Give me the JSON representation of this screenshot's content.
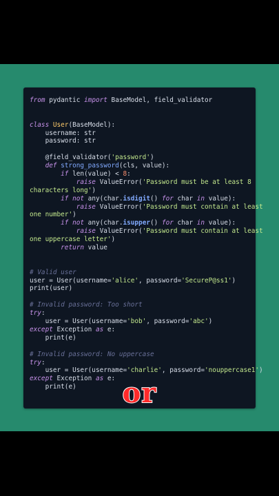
{
  "code_lines": [
    [
      {
        "t": "from",
        "c": "kw-it"
      },
      {
        "t": " pydantic ",
        "c": "plain"
      },
      {
        "t": "import",
        "c": "kw-it"
      },
      {
        "t": " BaseModel, field_validator",
        "c": "plain"
      }
    ],
    [],
    [],
    [
      {
        "t": "class",
        "c": "kw-it"
      },
      {
        "t": " User",
        "c": "cls"
      },
      {
        "t": "(BaseModel):",
        "c": "plain"
      }
    ],
    [
      {
        "t": "    username: str",
        "c": "plain"
      }
    ],
    [
      {
        "t": "    password: str",
        "c": "plain"
      }
    ],
    [],
    [
      {
        "t": "    @field_validator(",
        "c": "plain"
      },
      {
        "t": "'password'",
        "c": "str"
      },
      {
        "t": ")",
        "c": "plain"
      }
    ],
    [
      {
        "t": "    def",
        "c": "kw-it"
      },
      {
        "t": " strong_password",
        "c": "fn"
      },
      {
        "t": "(cls, value):",
        "c": "plain"
      }
    ],
    [
      {
        "t": "        if",
        "c": "kw-it"
      },
      {
        "t": " len(value) < ",
        "c": "plain"
      },
      {
        "t": "8",
        "c": "num"
      },
      {
        "t": ":",
        "c": "plain"
      }
    ],
    [
      {
        "t": "            raise",
        "c": "kw-it"
      },
      {
        "t": " ValueError(",
        "c": "plain"
      },
      {
        "t": "'Password must be at least 8",
        "c": "str"
      }
    ],
    [
      {
        "t": "characters long'",
        "c": "str"
      },
      {
        "t": ")",
        "c": "plain"
      }
    ],
    [
      {
        "t": "        if",
        "c": "kw-it"
      },
      {
        "t": " not",
        "c": "kw-it"
      },
      {
        "t": " any(char.",
        "c": "plain"
      },
      {
        "t": "isdigit",
        "c": "fn bold"
      },
      {
        "t": "() ",
        "c": "plain"
      },
      {
        "t": "for",
        "c": "kw-it"
      },
      {
        "t": " char ",
        "c": "plain"
      },
      {
        "t": "in",
        "c": "kw-it"
      },
      {
        "t": " value):",
        "c": "plain"
      }
    ],
    [
      {
        "t": "            raise",
        "c": "kw-it"
      },
      {
        "t": " ValueError(",
        "c": "plain"
      },
      {
        "t": "'Password must contain at least",
        "c": "str"
      }
    ],
    [
      {
        "t": "one number'",
        "c": "str"
      },
      {
        "t": ")",
        "c": "plain"
      }
    ],
    [
      {
        "t": "        if",
        "c": "kw-it"
      },
      {
        "t": " not",
        "c": "kw-it"
      },
      {
        "t": " any(char.",
        "c": "plain"
      },
      {
        "t": "isupper",
        "c": "fn bold"
      },
      {
        "t": "() ",
        "c": "plain"
      },
      {
        "t": "for",
        "c": "kw-it"
      },
      {
        "t": " char ",
        "c": "plain"
      },
      {
        "t": "in",
        "c": "kw-it"
      },
      {
        "t": " value):",
        "c": "plain"
      }
    ],
    [
      {
        "t": "            raise",
        "c": "kw-it"
      },
      {
        "t": " ValueError(",
        "c": "plain"
      },
      {
        "t": "'Password must contain at least",
        "c": "str"
      }
    ],
    [
      {
        "t": "one uppercase letter'",
        "c": "str"
      },
      {
        "t": ")",
        "c": "plain"
      }
    ],
    [
      {
        "t": "        return",
        "c": "kw-it"
      },
      {
        "t": " value",
        "c": "plain"
      }
    ],
    [],
    [],
    [
      {
        "t": "# Valid user",
        "c": "cm"
      }
    ],
    [
      {
        "t": "user = User(username=",
        "c": "plain"
      },
      {
        "t": "'alice'",
        "c": "str"
      },
      {
        "t": ", password=",
        "c": "plain"
      },
      {
        "t": "'SecureP@ss1'",
        "c": "str"
      },
      {
        "t": ")",
        "c": "plain"
      }
    ],
    [
      {
        "t": "print(user)",
        "c": "plain"
      }
    ],
    [],
    [
      {
        "t": "# Invalid password: Too short",
        "c": "cm"
      }
    ],
    [
      {
        "t": "try",
        "c": "kw-it"
      },
      {
        "t": ":",
        "c": "plain"
      }
    ],
    [
      {
        "t": "    user = User(username=",
        "c": "plain"
      },
      {
        "t": "'bob'",
        "c": "str"
      },
      {
        "t": ", password=",
        "c": "plain"
      },
      {
        "t": "'abc'",
        "c": "str"
      },
      {
        "t": ")",
        "c": "plain"
      }
    ],
    [
      {
        "t": "except",
        "c": "kw-it"
      },
      {
        "t": " Exception ",
        "c": "plain"
      },
      {
        "t": "as",
        "c": "kw-it"
      },
      {
        "t": " e:",
        "c": "plain"
      }
    ],
    [
      {
        "t": "    print(e)",
        "c": "plain"
      }
    ],
    [],
    [
      {
        "t": "# Invalid password: No uppercase",
        "c": "cm"
      }
    ],
    [
      {
        "t": "try",
        "c": "kw-it"
      },
      {
        "t": ":",
        "c": "plain"
      }
    ],
    [
      {
        "t": "    user = User(username=",
        "c": "plain"
      },
      {
        "t": "'charlie'",
        "c": "str"
      },
      {
        "t": ", password=",
        "c": "plain"
      },
      {
        "t": "'nouppercase1'",
        "c": "str"
      },
      {
        "t": ")",
        "c": "plain"
      }
    ],
    [
      {
        "t": "except",
        "c": "kw-it"
      },
      {
        "t": " Exception ",
        "c": "plain"
      },
      {
        "t": "as",
        "c": "kw-it"
      },
      {
        "t": " e:",
        "c": "plain"
      }
    ],
    [
      {
        "t": "    print(e)",
        "c": "plain"
      }
    ]
  ],
  "overlay": {
    "word": "or"
  },
  "colors": {
    "page_background": "#000000",
    "band": "#268a6d",
    "card": "#0e1622",
    "overlay_fill": "#ff2a2a",
    "overlay_outline": "#ffffff"
  }
}
